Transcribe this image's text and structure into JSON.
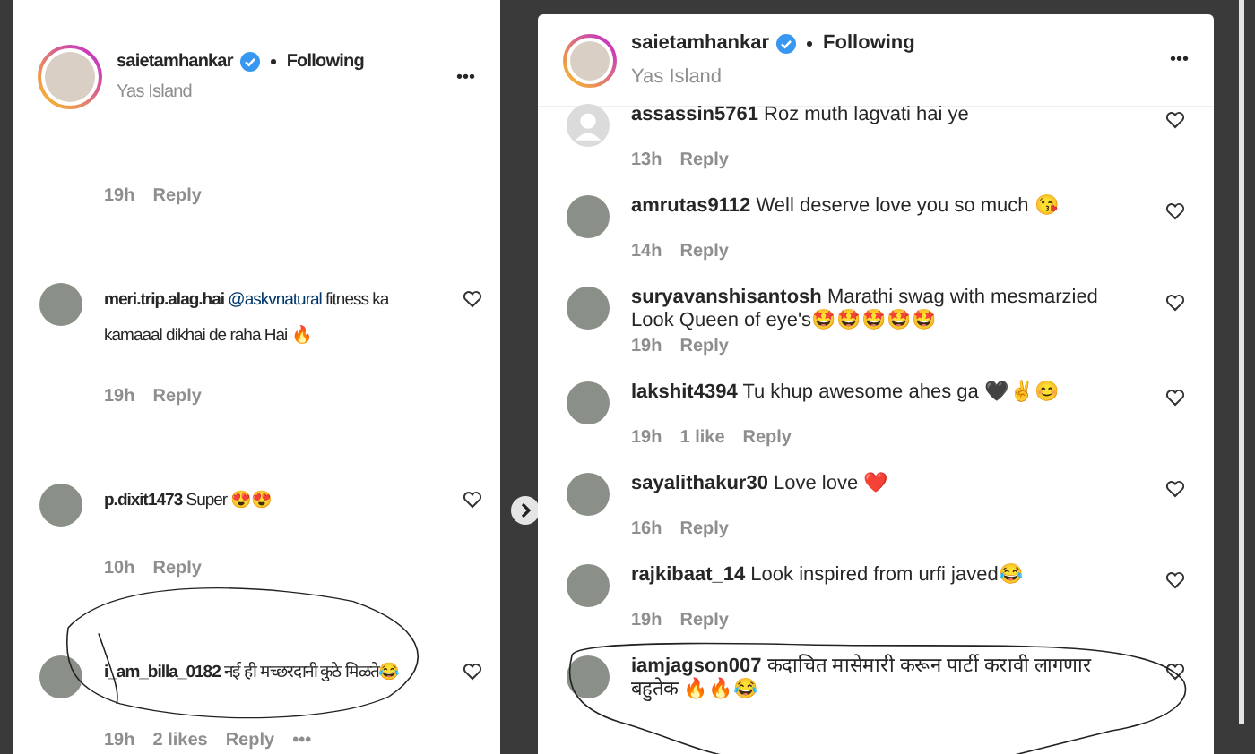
{
  "panels": [
    {
      "kind": "left",
      "author": "saietamhankar",
      "following": "Following",
      "location": "Yas Island",
      "more": "•••",
      "comments": [
        {
          "meta": [
            "19h",
            "Reply"
          ]
        },
        {
          "username": "meri.trip.alag.hai",
          "mention": "@askvnatural",
          "text": "fitness ka kamaaal dikhai de raha Hai 🔥",
          "meta": [
            "19h",
            "Reply"
          ]
        },
        {
          "username": "p.dixit1473",
          "text": "Super 😍😍",
          "meta": [
            "10h",
            "Reply"
          ]
        },
        {
          "username": "i_am_billa_0182",
          "text": "नई ही मच्छरदानी कुठे मिळते😂",
          "meta": [
            "19h",
            "2 likes",
            "Reply",
            "•••"
          ]
        }
      ]
    },
    {
      "kind": "right",
      "author": "saietamhankar",
      "following": "Following",
      "location": "Yas Island",
      "more": "•••",
      "comments": [
        {
          "username": "assassin5761",
          "text": "Roz muth lagvati hai ye",
          "meta": [
            "13h",
            "Reply"
          ],
          "default_avatar": true
        },
        {
          "username": "amrutas9112",
          "text": "Well deserve love you so much 😘",
          "meta": [
            "14h",
            "Reply"
          ]
        },
        {
          "username": "suryavanshisantosh",
          "text": "Marathi swag with mesmarzied Look Queen of eye's🤩🤩🤩🤩🤩",
          "meta": [
            "19h",
            "Reply"
          ]
        },
        {
          "username": "lakshit4394",
          "text": "Tu khup awesome ahes ga 🖤✌😊",
          "meta": [
            "19h",
            "1 like",
            "Reply"
          ]
        },
        {
          "username": "sayalithakur30",
          "text": "Love love ❤️",
          "meta": [
            "16h",
            "Reply"
          ]
        },
        {
          "username": "rajkibaat_14",
          "text": "Look inspired from urfi javed😂",
          "meta": [
            "19h",
            "Reply"
          ]
        },
        {
          "username": "iamjagson007",
          "text": "कदाचित मासेमारी करून पार्टी करावी लागणार बहुतेक 🔥🔥😂"
        }
      ]
    }
  ]
}
